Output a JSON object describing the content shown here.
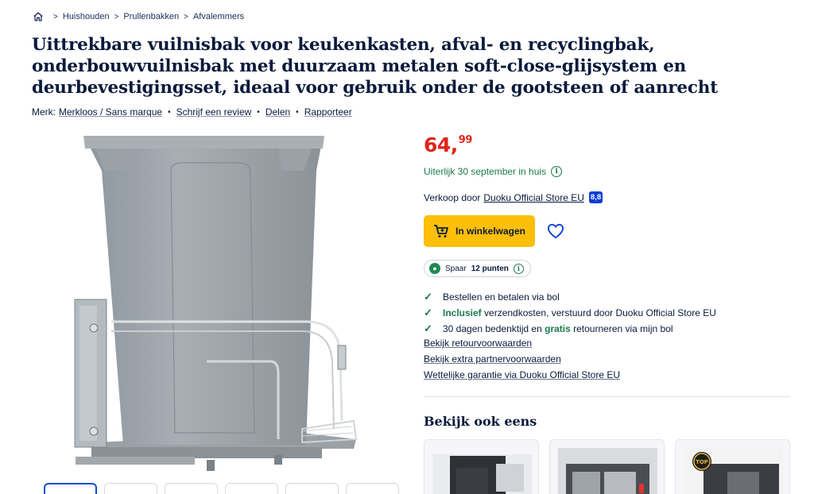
{
  "breadcrumb": {
    "items": [
      "Huishouden",
      "Prullenbakken",
      "Afvalemmers"
    ]
  },
  "product": {
    "title": "Uittrekbare vuilnisbak voor keukenkasten, afval- en recyclingbak, onderbouwvuilnisbak met duurzaam metalen soft-close-glijsystem en deurbevestigingsset, ideaal voor gebruik onder de gootsteen of aanrecht",
    "brand_label": "Merk:",
    "brand": "Merkloos / Sans marque",
    "review_link": "Schrijf een review",
    "share_link": "Delen",
    "report_link": "Rapporteer"
  },
  "offer": {
    "price_whole": "64,",
    "price_cents": "99",
    "delivery": "Uiterlijk 30 september in huis",
    "seller_prefix": "Verkoop door",
    "seller_name": "Duoku Official Store EU",
    "seller_score": "8,8",
    "cart_label": "In winkelwagen",
    "points_prefix": "Spaar",
    "points_value": "12 punten"
  },
  "usps": [
    {
      "pre": "",
      "bold": "",
      "post": "Bestellen en betalen via bol"
    },
    {
      "pre": "",
      "bold": "Inclusief",
      "post": " verzendkosten, verstuurd door Duoku Official Store EU"
    },
    {
      "pre": "30 dagen bedenktijd en ",
      "bold": "gratis",
      "post": " retourneren via mijn bol"
    }
  ],
  "links": {
    "returns": "Bekijk retourvoorwaarden",
    "partner": "Bekijk extra partnervoorwaarden",
    "warranty": "Wettelijke garantie via Duoku Official Store EU"
  },
  "see_also": {
    "title": "Bekijk ook eens",
    "badge": "TOP"
  },
  "colors": {
    "price": "#e0251b",
    "accent_green": "#1a7a4d",
    "cart_yellow": "#fdbf07",
    "score_blue": "#0b3ed7"
  }
}
